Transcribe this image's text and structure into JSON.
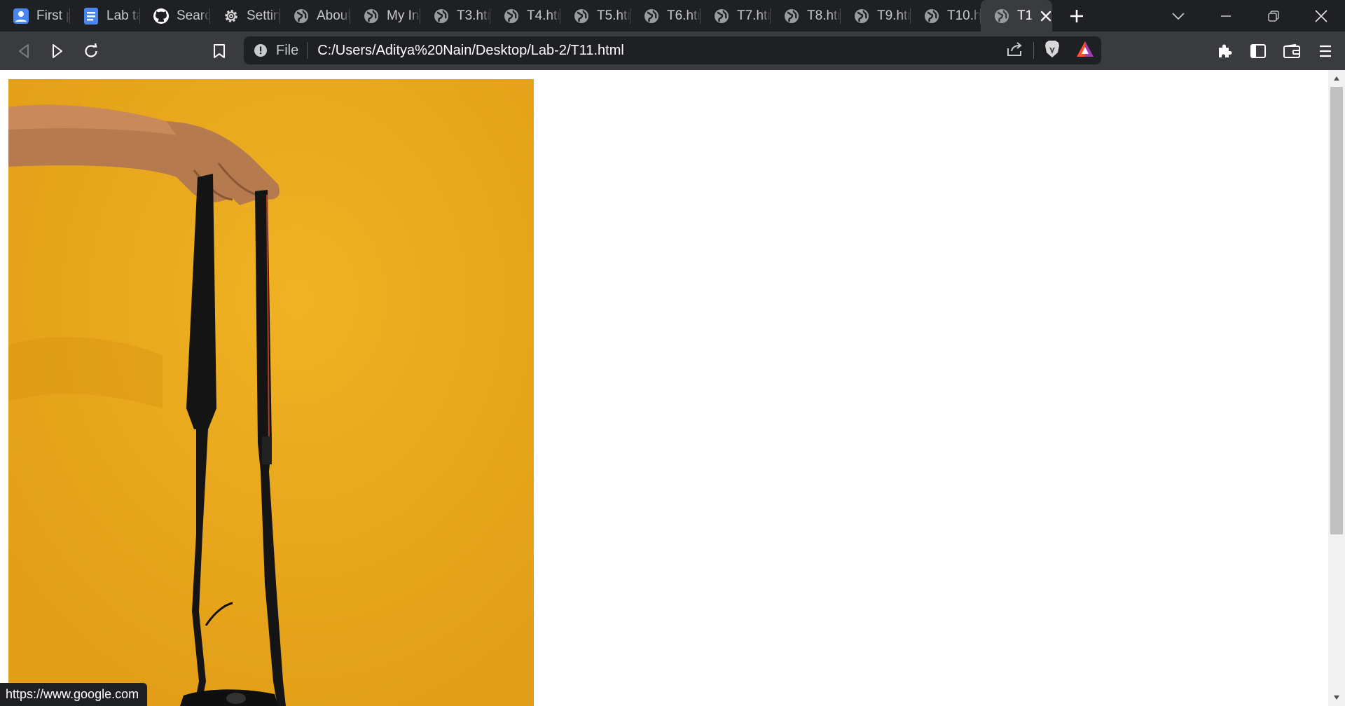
{
  "tabs": [
    {
      "label": "First p",
      "icon": "user-profile-icon"
    },
    {
      "label": "Lab ta",
      "icon": "document-icon"
    },
    {
      "label": "Searc",
      "icon": "github-icon"
    },
    {
      "label": "Settin",
      "icon": "gear-icon"
    },
    {
      "label": "About",
      "icon": "globe-icon"
    },
    {
      "label": "My In",
      "icon": "globe-icon"
    },
    {
      "label": "T3.htr",
      "icon": "globe-icon"
    },
    {
      "label": "T4.htr",
      "icon": "globe-icon"
    },
    {
      "label": "T5.htr",
      "icon": "globe-icon"
    },
    {
      "label": "T6.htr",
      "icon": "globe-icon"
    },
    {
      "label": "T7.htr",
      "icon": "globe-icon"
    },
    {
      "label": "T8.htr",
      "icon": "globe-icon"
    },
    {
      "label": "T9.htr",
      "icon": "globe-icon"
    },
    {
      "label": "T10.ht",
      "icon": "globe-icon"
    }
  ],
  "active_tab": {
    "label": "T1",
    "icon": "globe-icon"
  },
  "address_bar": {
    "scheme_label": "File",
    "url": "C:/Users/Aditya%20Nain/Desktop/Lab-2/T11.html"
  },
  "status_bar": {
    "link": "https://www.google.com"
  },
  "colors": {
    "tabstrip_bg": "#1f2023",
    "toolbar_bg": "#3a3b3f",
    "photo_background": "#e9a81f",
    "brave_accent": "#fb542b"
  }
}
